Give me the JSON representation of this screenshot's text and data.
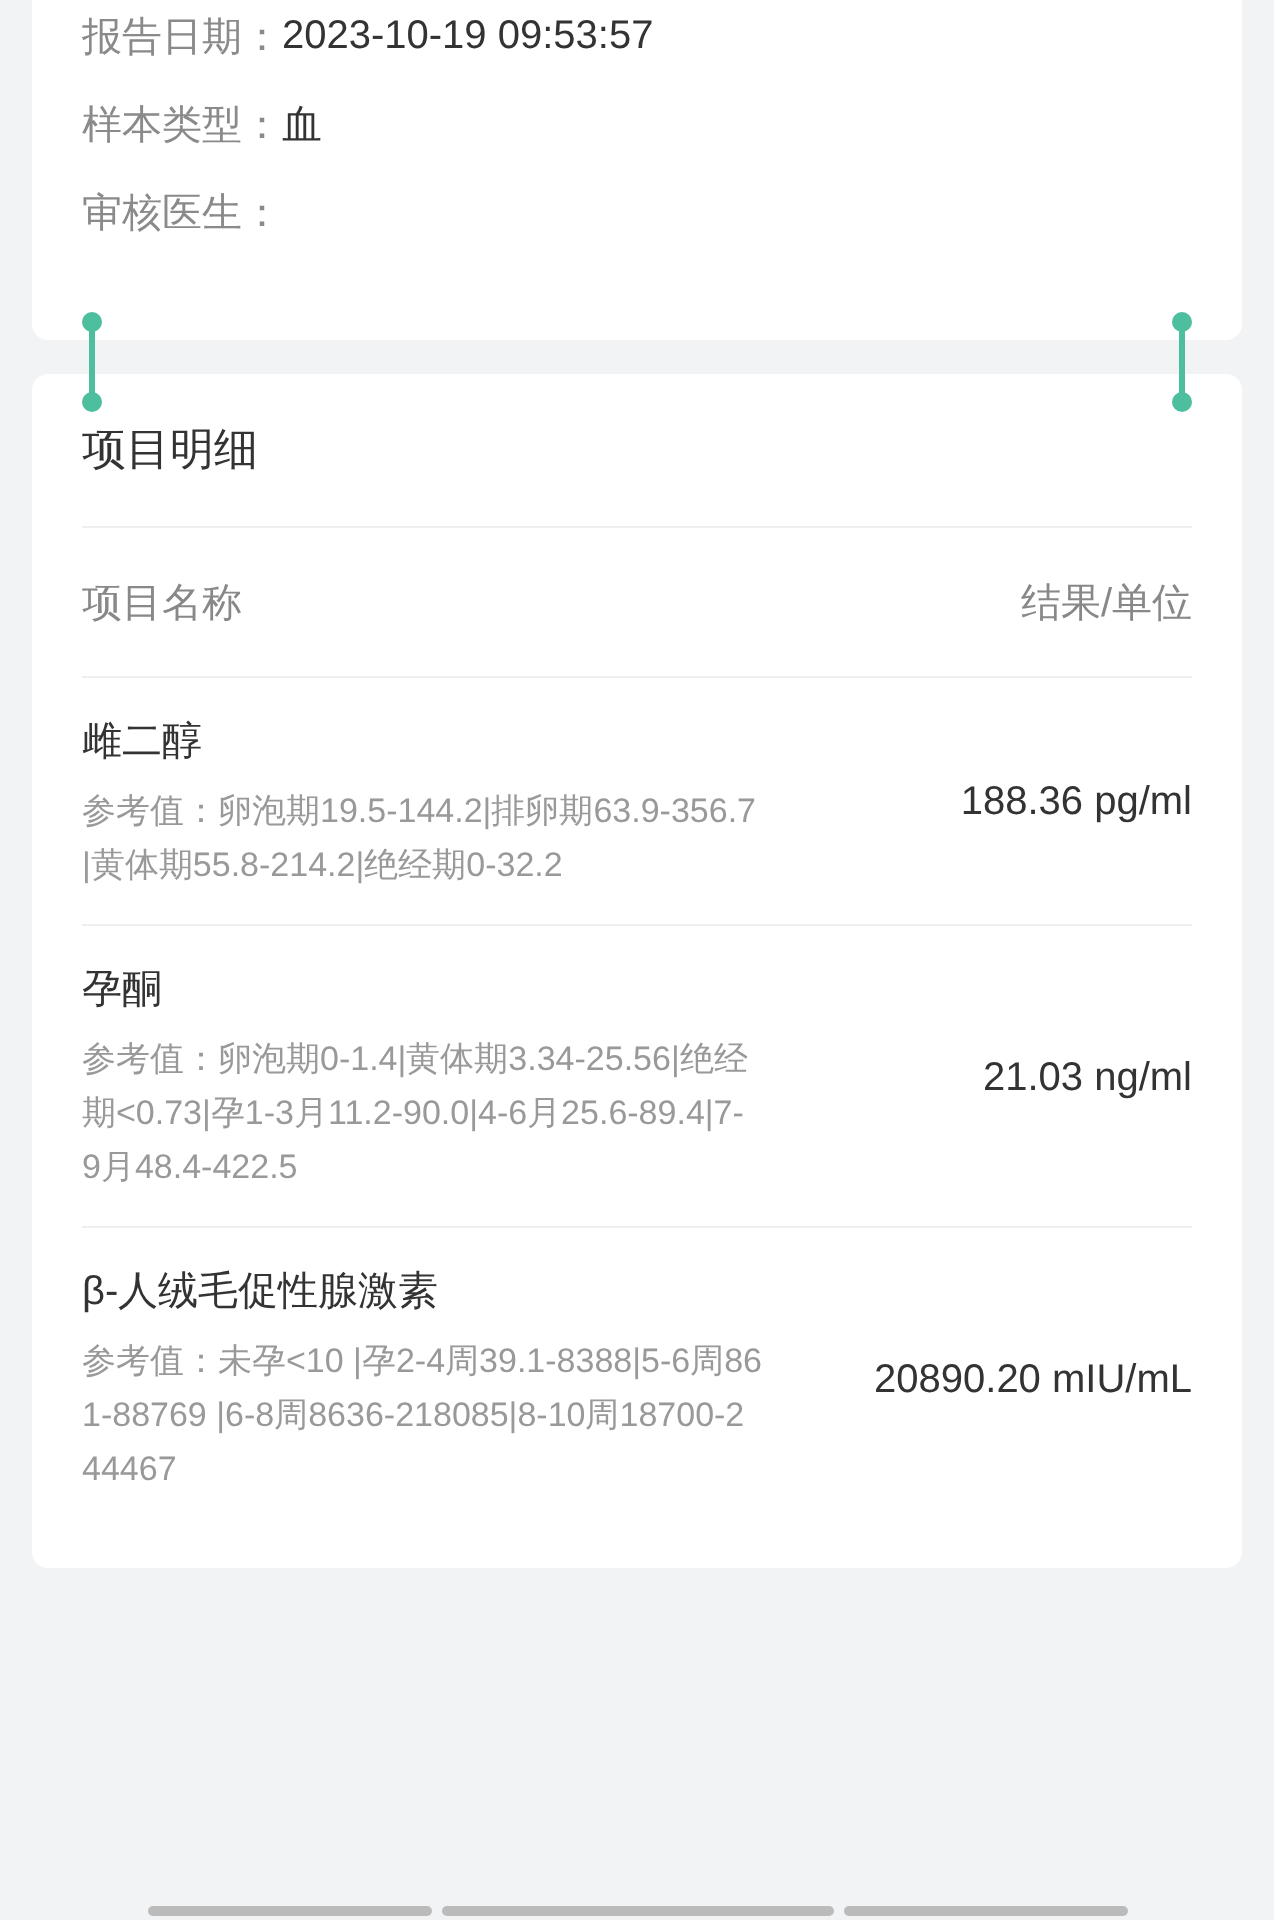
{
  "report_info": [
    {
      "label": "报告日期：",
      "value": "2023-10-19 09:53:57"
    },
    {
      "label": "样本类型：",
      "value": "血"
    },
    {
      "label": "审核医生："
    }
  ],
  "details": {
    "title": "项目明细",
    "columns": [
      "项目名称",
      "结果/单位"
    ],
    "items": [
      {
        "name": "雌二醇",
        "reference": "参考值：卵泡期19.5-144.2|排卵期63.9-356.7|黄体期55.8-214.2|绝经期0-32.2",
        "result": "188.36 pg/ml"
      },
      {
        "name": "孕酮",
        "reference": "参考值：卵泡期0-1.4|黄体期3.34-25.56|绝经期<0.73|孕1-3月11.2-90.0|4-6月25.6-89.4|7-9月48.4-422.5",
        "result": "21.03 ng/ml"
      },
      {
        "name": "β-人绒毛促性腺激素",
        "reference": "参考值：未孕<10 |孕2-4周39.1-8388|5-6周861-88769 |6-8周8636-218085|8-10周18700-244467",
        "result": "20890.20 mIU/mL"
      }
    ]
  }
}
